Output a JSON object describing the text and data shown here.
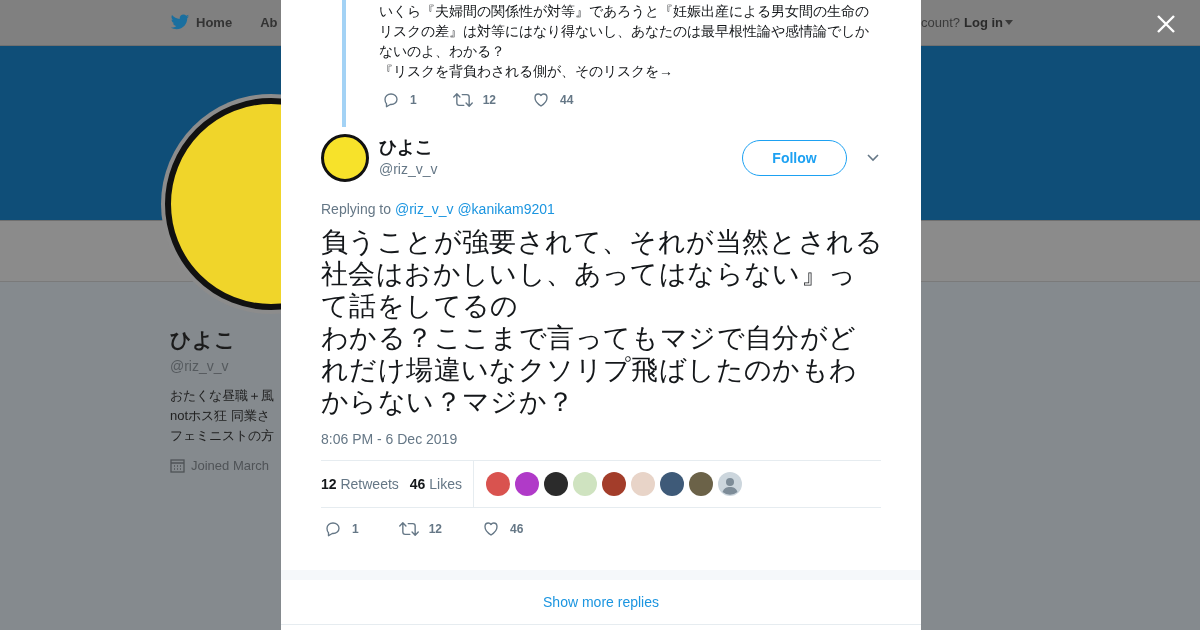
{
  "background_page": {
    "nav": {
      "home": "Home",
      "about": "Ab",
      "account_prompt": "count?",
      "login": "Log in"
    },
    "profile": {
      "name": "ひよこ",
      "handle": "@riz_v_v",
      "bio_lines": [
        "おたくな昼職＋風",
        "notホス狂 同業さ",
        "フェミニストの方"
      ],
      "joined": "Joined March"
    }
  },
  "modal": {
    "previous_tweet": {
      "text_lines": [
        "いくら『夫婦間の関係性が対等』であろうと『妊娠出産による男女間の生命の",
        "リスクの差』は対等にはなり得ないし、あなたのは最早根性論や感情論でしか",
        "ないのよ、わかる？",
        "『リスクを背負わされる側が、そのリスクを→"
      ],
      "actions": [
        {
          "kind": "reply",
          "count": "1"
        },
        {
          "kind": "retweet",
          "count": "12"
        },
        {
          "kind": "like",
          "count": "44"
        }
      ]
    },
    "tweet": {
      "author": {
        "name": "ひよこ",
        "handle": "@riz_v_v"
      },
      "follow": "Follow",
      "replying_label": "Replying to",
      "replying_to": [
        "@riz_v_v",
        "@kanikam9201"
      ],
      "text_lines": [
        "負うことが強要されて、それが当然とされる",
        "社会はおかしいし、あってはならない』っ",
        "て話をしてるの",
        "わかる？ここまで言ってもマジで自分がど",
        "れだけ場違いなクソリプ飛ばしたのかもわ",
        "からない？マジか？"
      ],
      "timestamp": "8:06 PM - 6 Dec 2019",
      "stats": [
        {
          "count": "12",
          "label": "Retweets"
        },
        {
          "count": "46",
          "label": "Likes"
        }
      ],
      "likers": [
        {
          "kind": "picture"
        },
        {
          "kind": "picture"
        },
        {
          "kind": "picture"
        },
        {
          "kind": "picture"
        },
        {
          "kind": "picture"
        },
        {
          "kind": "picture"
        },
        {
          "kind": "picture"
        },
        {
          "kind": "picture"
        },
        {
          "kind": "default"
        }
      ],
      "actions": [
        {
          "kind": "reply",
          "count": "1"
        },
        {
          "kind": "retweet",
          "count": "12"
        },
        {
          "kind": "like",
          "count": "46"
        }
      ]
    },
    "show_more": "Show more replies"
  }
}
